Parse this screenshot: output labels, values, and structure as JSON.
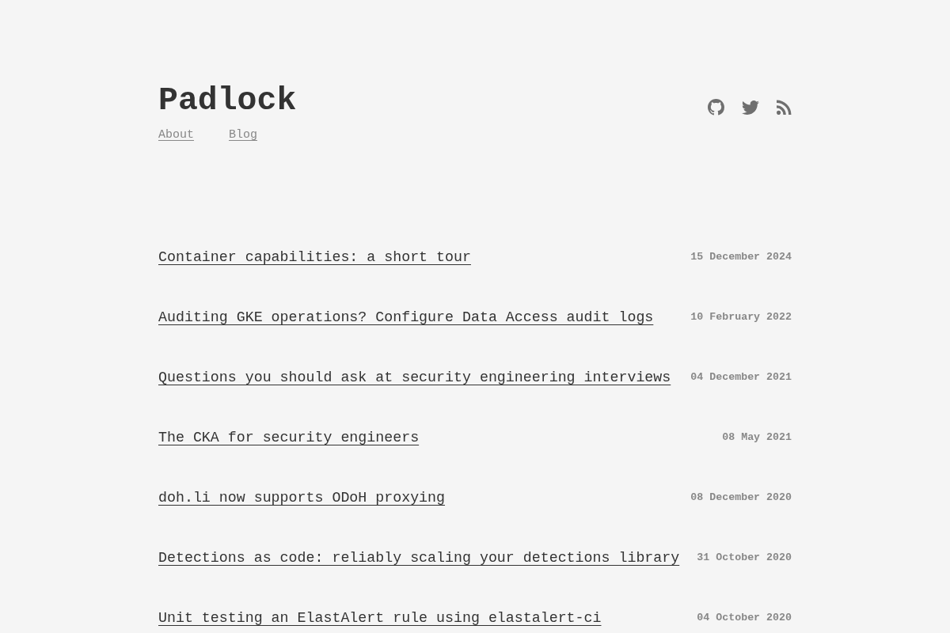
{
  "header": {
    "title": "Padlock",
    "nav": [
      {
        "label": "About"
      },
      {
        "label": "Blog"
      }
    ]
  },
  "posts": [
    {
      "title": "Container capabilities: a short tour",
      "date": "15 December 2024"
    },
    {
      "title": "Auditing GKE operations? Configure Data Access audit logs",
      "date": "10 February 2022"
    },
    {
      "title": "Questions you should ask at security engineering interviews",
      "date": "04 December 2021"
    },
    {
      "title": "The CKA for security engineers",
      "date": "08 May 2021"
    },
    {
      "title": "doh.li now supports ODoH proxying",
      "date": "08 December 2020"
    },
    {
      "title": "Detections as code: reliably scaling your detections library",
      "date": "31 October 2020"
    },
    {
      "title": "Unit testing an ElastAlert rule using elastalert-ci",
      "date": "04 October 2020"
    }
  ]
}
